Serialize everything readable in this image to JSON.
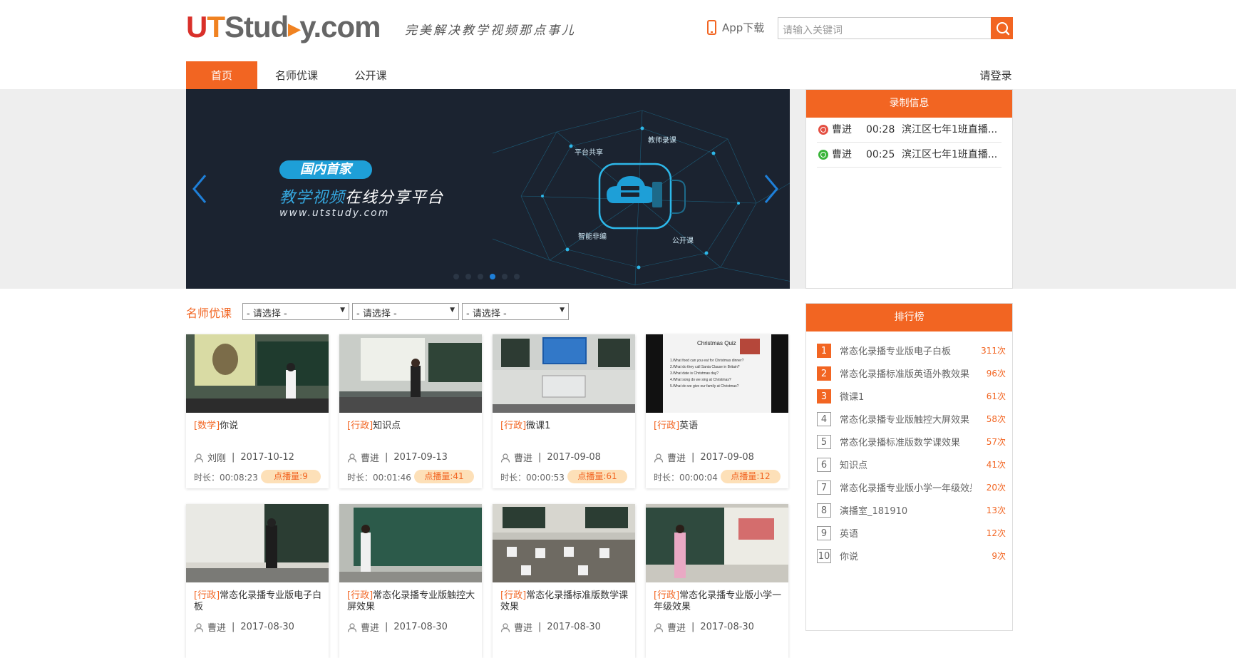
{
  "header": {
    "logo": {
      "u": "U",
      "t": "T",
      "rest_a": "Stud",
      "rest_b": "y.com"
    },
    "slogan": "完美解决教学视频那点事儿",
    "app_download": "App下载",
    "search": {
      "placeholder": "请输入关键词"
    }
  },
  "nav": {
    "items": [
      {
        "label": "首页"
      },
      {
        "label": "名师优课"
      },
      {
        "label": "公开课"
      }
    ],
    "login": "请登录"
  },
  "banner": {
    "badge": "国内首家",
    "title_highlight": "教学视频",
    "title_rest": "在线分享平台",
    "url": "www.utstudy.com",
    "labels": [
      "平台共享",
      "教师录课",
      "智能非编",
      "公开课"
    ],
    "active_slide": 4,
    "slide_count": 6
  },
  "record_panel": {
    "title": "录制信息",
    "rows": [
      {
        "status": "red",
        "name": "曹进",
        "time": "00:28",
        "title": "滨江区七年1班直播..."
      },
      {
        "status": "green",
        "name": "曹进",
        "time": "00:25",
        "title": "滨江区七年1班直播..."
      }
    ]
  },
  "courses": {
    "section_title": "名师优课",
    "filters": [
      "- 请选择 -",
      "- 请选择 -",
      "- 请选择 -"
    ],
    "items": [
      {
        "category": "[数学]",
        "title": "你说",
        "author": "刘刚",
        "date": "2017-10-12",
        "duration": "时长：00:08:23",
        "views": "点播量:9"
      },
      {
        "category": "[行政]",
        "title": "知识点",
        "author": "曹进",
        "date": "2017-09-13",
        "duration": "时长：00:01:46",
        "views": "点播量:41"
      },
      {
        "category": "[行政]",
        "title": "微课1",
        "author": "曹进",
        "date": "2017-09-08",
        "duration": "时长：00:00:53",
        "views": "点播量:61"
      },
      {
        "category": "[行政]",
        "title": "英语",
        "author": "曹进",
        "date": "2017-09-08",
        "duration": "时长：00:00:04",
        "views": "点播量:12"
      },
      {
        "category": "[行政]",
        "title": "常态化录播专业版电子白板",
        "author": "曹进",
        "date": "2017-08-30",
        "duration": "",
        "views": ""
      },
      {
        "category": "[行政]",
        "title": "常态化录播专业版触控大屏效果",
        "author": "曹进",
        "date": "2017-08-30",
        "duration": "",
        "views": ""
      },
      {
        "category": "[行政]",
        "title": "常态化录播标准版数学课效果",
        "author": "曹进",
        "date": "2017-08-30",
        "duration": "",
        "views": ""
      },
      {
        "category": "[行政]",
        "title": "常态化录播专业版小学一年级效果",
        "author": "曹进",
        "date": "2017-08-30",
        "duration": "",
        "views": ""
      }
    ],
    "quiz_thumb": {
      "heading": "Christmas Quiz",
      "lines": [
        "1.What food can you eat for Christmas dinner?",
        "2.What do they call Santa Clause in Britain?",
        "3.What date is Christmas day?",
        "4.What song do we sing at Christmas?",
        "5.What do we give our family at Christmas?"
      ]
    }
  },
  "ranking": {
    "title": "排行榜",
    "items": [
      {
        "rank": "1",
        "title": "常态化录播专业版电子白板",
        "count": "311次"
      },
      {
        "rank": "2",
        "title": "常态化录播标准版英语外教效果",
        "count": "96次"
      },
      {
        "rank": "3",
        "title": "微课1",
        "count": "61次"
      },
      {
        "rank": "4",
        "title": "常态化录播专业版触控大屏效果",
        "count": "58次"
      },
      {
        "rank": "5",
        "title": "常态化录播标准版数学课效果",
        "count": "57次"
      },
      {
        "rank": "6",
        "title": "知识点",
        "count": "41次"
      },
      {
        "rank": "7",
        "title": "常态化录播专业版小学一年级效果",
        "count": "20次"
      },
      {
        "rank": "8",
        "title": "演播室_181910",
        "count": "13次"
      },
      {
        "rank": "9",
        "title": "英语",
        "count": "12次"
      },
      {
        "rank": "10",
        "title": " 你说",
        "count": "9次"
      }
    ]
  },
  "colors": {
    "accent": "#f26522",
    "banner_bg": "#1b2330",
    "banner_blue": "#1e9fd7"
  }
}
